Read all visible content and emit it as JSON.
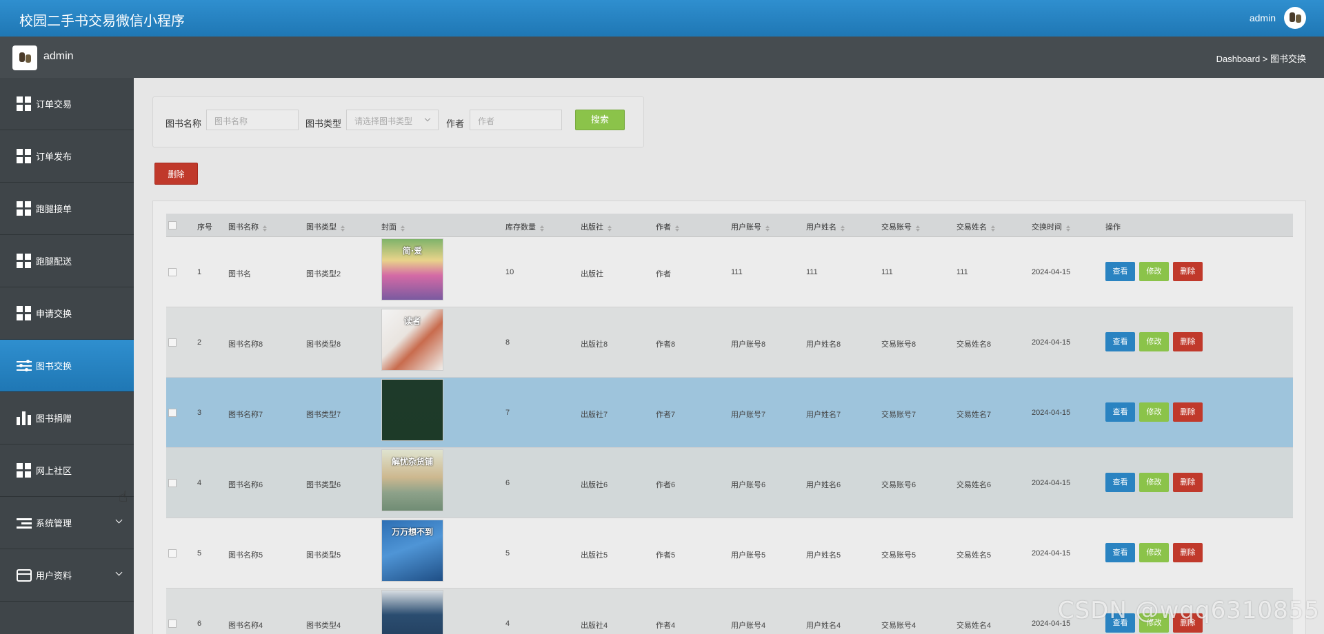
{
  "header": {
    "title": "校园二手书交易微信小程序",
    "user": "admin"
  },
  "subbar": {
    "name": "admin",
    "breadcrumb": "Dashboard > 图书交换"
  },
  "sidebar": {
    "items": [
      {
        "label": "订单交易",
        "icon": "grid-icon"
      },
      {
        "label": "订单发布",
        "icon": "grid-icon"
      },
      {
        "label": "跑腿接单",
        "icon": "grid-icon"
      },
      {
        "label": "跑腿配送",
        "icon": "grid-icon"
      },
      {
        "label": "申请交换",
        "icon": "grid-icon"
      },
      {
        "label": "图书交换",
        "icon": "sliders-icon",
        "active": true
      },
      {
        "label": "图书捐赠",
        "icon": "bar-chart-icon"
      },
      {
        "label": "网上社区",
        "icon": "grid-icon"
      },
      {
        "label": "系统管理",
        "icon": "list-icon",
        "expandable": true
      },
      {
        "label": "用户资料",
        "icon": "card-icon",
        "expandable": true
      }
    ]
  },
  "search": {
    "name_label": "图书名称",
    "name_placeholder": "图书名称",
    "type_label": "图书类型",
    "type_placeholder": "请选择图书类型",
    "author_label": "作者",
    "author_placeholder": "作者",
    "button": "搜索"
  },
  "actions": {
    "delete_label": "删除"
  },
  "table": {
    "headers": [
      "序号",
      "图书名称",
      "图书类型",
      "封面",
      "库存数量",
      "出版社",
      "作者",
      "用户账号",
      "用户姓名",
      "交易账号",
      "交易姓名",
      "交换时间",
      "操作"
    ],
    "ops": {
      "view": "查看",
      "edit": "修改",
      "delete": "删除"
    },
    "rows": [
      {
        "no": "1",
        "name": "图书名",
        "type": "图书类型2",
        "stock": "10",
        "publisher": "出版社",
        "author": "作者",
        "user_account": "111",
        "user_name": "111",
        "trade_account": "111",
        "trade_name": "111",
        "time": "2024-04-15",
        "cover_title": "简·爱"
      },
      {
        "no": "2",
        "name": "图书名称8",
        "type": "图书类型8",
        "stock": "8",
        "publisher": "出版社8",
        "author": "作者8",
        "user_account": "用户账号8",
        "user_name": "用户姓名8",
        "trade_account": "交易账号8",
        "trade_name": "交易姓名8",
        "time": "2024-04-15",
        "cover_title": "读者"
      },
      {
        "no": "3",
        "name": "图书名称7",
        "type": "图书类型7",
        "stock": "7",
        "publisher": "出版社7",
        "author": "作者7",
        "user_account": "用户账号7",
        "user_name": "用户姓名7",
        "trade_account": "交易账号7",
        "trade_name": "交易姓名7",
        "time": "2024-04-15",
        "cover_title": ""
      },
      {
        "no": "4",
        "name": "图书名称6",
        "type": "图书类型6",
        "stock": "6",
        "publisher": "出版社6",
        "author": "作者6",
        "user_account": "用户账号6",
        "user_name": "用户姓名6",
        "trade_account": "交易账号6",
        "trade_name": "交易姓名6",
        "time": "2024-04-15",
        "cover_title": "解忧杂货铺"
      },
      {
        "no": "5",
        "name": "图书名称5",
        "type": "图书类型5",
        "stock": "5",
        "publisher": "出版社5",
        "author": "作者5",
        "user_account": "用户账号5",
        "user_name": "用户姓名5",
        "trade_account": "交易账号5",
        "trade_name": "交易姓名5",
        "time": "2024-04-15",
        "cover_title": "万万想不到"
      },
      {
        "no": "6",
        "name": "图书名称4",
        "type": "图书类型4",
        "stock": "4",
        "publisher": "出版社4",
        "author": "作者4",
        "user_account": "用户账号4",
        "user_name": "用户姓名4",
        "trade_account": "交易账号4",
        "trade_name": "交易姓名4",
        "time": "2024-04-15",
        "cover_title": ""
      }
    ]
  },
  "watermark": "CSDN @wqq6310855",
  "colors": {
    "primary": "#2a83c1",
    "success": "#8bc34a",
    "danger": "#c0392b",
    "sidebar": "#3f4549",
    "highlight_row": "#9ec4dc"
  }
}
